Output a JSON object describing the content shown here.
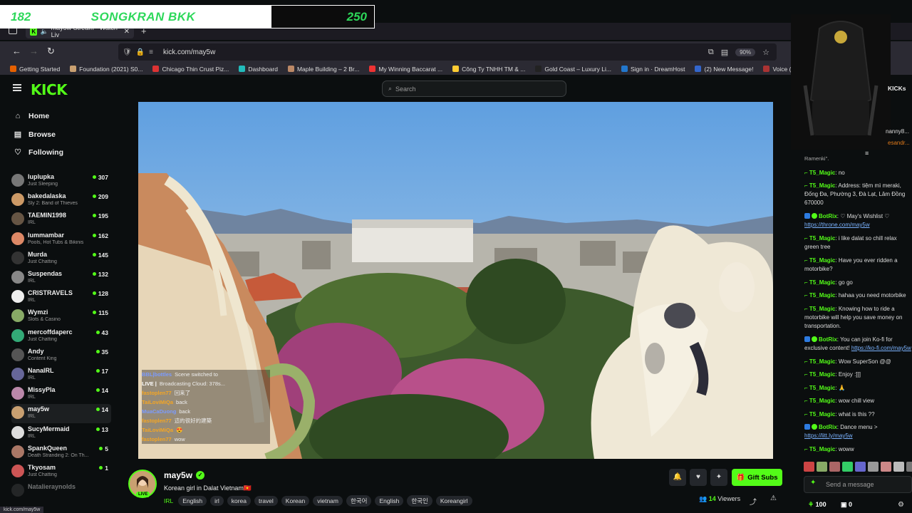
{
  "banner": {
    "left_number": "182",
    "title": "SONGKRAN BKK",
    "right_number": "250"
  },
  "browser": {
    "tab_title": "may5w Stream - Watch Liv",
    "url": "kick.com/may5w",
    "zoom": "90%",
    "bookmarks": [
      {
        "label": "Getting Started",
        "color": "#e66000"
      },
      {
        "label": "Foundation (2021) S0...",
        "color": "#c9a071"
      },
      {
        "label": "Chicago Thin Crust Piz...",
        "color": "#d33"
      },
      {
        "label": "Dashboard",
        "color": "#2bb"
      },
      {
        "label": "Maple Building – 2 Br...",
        "color": "#b86"
      },
      {
        "label": "My Winning Baccarat ...",
        "color": "#e33"
      },
      {
        "label": "Công Ty TNHH TM & ...",
        "color": "#fc3"
      },
      {
        "label": "Gold Coast – Luxury Li...",
        "color": "#222"
      },
      {
        "label": "Sign in · DreamHost",
        "color": "#27c"
      },
      {
        "label": "(2) New Message!",
        "color": "#36c"
      },
      {
        "label": "Voice (Korean Drama) ...",
        "color": "#a33"
      }
    ]
  },
  "kick": {
    "logo": "KICK",
    "search_placeholder": "Search",
    "nav": [
      {
        "label": "Home",
        "icon": "home-icon",
        "glyph": "⌂"
      },
      {
        "label": "Browse",
        "icon": "browse-icon",
        "glyph": "▤"
      },
      {
        "label": "Following",
        "icon": "heart-icon",
        "glyph": "♡"
      }
    ],
    "channels": [
      {
        "name": "luplupka",
        "sub": "Just Sleeping",
        "viewers": "307",
        "color": "#777"
      },
      {
        "name": "bakedalaska",
        "sub": "Sly 2: Band of Thieves",
        "viewers": "209",
        "color": "#c96"
      },
      {
        "name": "TAEMIN1998",
        "sub": "IRL",
        "viewers": "195",
        "color": "#654"
      },
      {
        "name": "lummambar",
        "sub": "Pools, Hot Tubs & Bikinis",
        "viewers": "162",
        "color": "#d86"
      },
      {
        "name": "Murda",
        "sub": "Just Chatting",
        "viewers": "145",
        "color": "#333"
      },
      {
        "name": "Suspendas",
        "sub": "IRL",
        "viewers": "132",
        "color": "#888"
      },
      {
        "name": "CRISTRAVELS",
        "sub": "IRL",
        "viewers": "128",
        "color": "#eee"
      },
      {
        "name": "Wymzi",
        "sub": "Slots & Casino",
        "viewers": "115",
        "color": "#8a6"
      },
      {
        "name": "mercoffdaperc",
        "sub": "Just Chatting",
        "viewers": "43",
        "color": "#3a7"
      },
      {
        "name": "Andy",
        "sub": "Content King",
        "viewers": "35",
        "color": "#555"
      },
      {
        "name": "NanaIRL",
        "sub": "IRL",
        "viewers": "17",
        "color": "#669"
      },
      {
        "name": "MissyPla",
        "sub": "IRL",
        "viewers": "14",
        "color": "#b8a"
      },
      {
        "name": "may5w",
        "sub": "IRL",
        "viewers": "14",
        "color": "#c9a071"
      },
      {
        "name": "SucyMermaid",
        "sub": "IRL",
        "viewers": "13",
        "color": "#ddd"
      },
      {
        "name": "SpankQueen",
        "sub": "Death Stranding 2: On Th...",
        "viewers": "5",
        "color": "#a76"
      },
      {
        "name": "Tkyosam",
        "sub": "Just Chatting",
        "viewers": "1",
        "color": "#c55"
      },
      {
        "name": "Natalieraynolds",
        "sub": "",
        "viewers": "",
        "color": "#444"
      }
    ],
    "stream": {
      "channel": "may5w",
      "title": "Korean girl in Dalat Vietnam🇻🇳",
      "category": "IRL",
      "tags": [
        "English",
        "irl",
        "korea",
        "travel",
        "Korean",
        "vietnam",
        "한국어",
        "English",
        "한국인",
        "Koreangirl"
      ],
      "live": "LIVE",
      "viewers": "14",
      "viewers_label": "Viewers",
      "gift_subs": "Gift Subs"
    },
    "overlay_chat": [
      {
        "user": "BBL|bottles",
        "text": "Scene switched to"
      },
      {
        "user": "LIVE |",
        "text": "Broadcasting Cloud: 378s..."
      },
      {
        "user": "fastoplen77",
        "text": "回来了"
      },
      {
        "user": "TaiLoviMiQa",
        "text": "back"
      },
      {
        "user": "MuaCaDuong",
        "text": "back"
      },
      {
        "user": "fastoplen77",
        "text": "這的很好的建築"
      },
      {
        "user": "TaiLoviMiQa",
        "text": "😍"
      },
      {
        "user": "fastoplen77",
        "text": "wow"
      }
    ],
    "chat": {
      "top_fragment": "Ramenki\".",
      "messages": [
        {
          "user": "T5_Magic",
          "text": "no"
        },
        {
          "user": "T5_Magic",
          "text": "Address: tiệm mì meraki, Đống Đa, Phường 3, Đà Lạt, Lâm Đồng 670000"
        },
        {
          "user": "BotRix",
          "text": "♡ May's Wishlist ♡ ",
          "link": "https://throne.com/may5w",
          "bot": true
        },
        {
          "user": "T5_Magic",
          "text": "i like dalat so chill relax green tree"
        },
        {
          "user": "T5_Magic",
          "text": "Have you ever ridden a motorbike?"
        },
        {
          "user": "T5_Magic",
          "text": "go go"
        },
        {
          "user": "T5_Magic",
          "text": "hahaa you need motorbike"
        },
        {
          "user": "T5_Magic",
          "text": "Knowing how to ride a motorbike will help you save money on transportation."
        },
        {
          "user": "BotRix",
          "text": "You can join Ko-fi for exclusive content! ",
          "link": "https://ko-fi.com/may5w",
          "bot": true
        },
        {
          "user": "T5_Magic",
          "text": "Wow SuperSon @@"
        },
        {
          "user": "T5_Magic",
          "text": "Enjoy :]]]"
        },
        {
          "user": "T5_Magic",
          "text": "🙏"
        },
        {
          "user": "T5_Magic",
          "text": "wow chill view"
        },
        {
          "user": "T5_Magic",
          "text": "what is this ??"
        },
        {
          "user": "BotRix",
          "text": "Dance menu > ",
          "link": "https://litt.ly/may5w",
          "bot": true
        },
        {
          "user": "T5_Magic",
          "text": "woww"
        }
      ],
      "input_placeholder": "Send a message",
      "points": "100",
      "subs_count": "0",
      "header_fragments": [
        "KICKs",
        "nanny8...",
        "esandr..."
      ]
    },
    "status_url": "kick.com/may5w"
  }
}
